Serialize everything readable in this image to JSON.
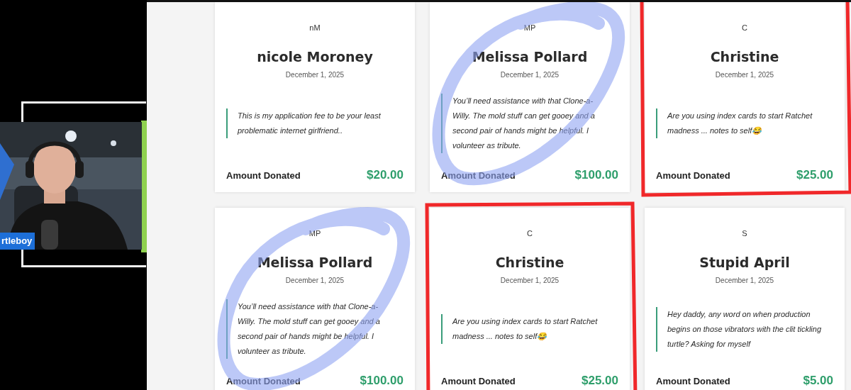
{
  "webcam": {
    "name_tag": "rtleboy"
  },
  "donations": [
    {
      "initials": "nM",
      "name": "nicole Moroney",
      "date": "December 1, 2025",
      "message": "This is my application fee to be your least problematic internet girlfriend..",
      "amount_label": "Amount Donated",
      "amount": "$20.00",
      "circled": false,
      "boxed": false
    },
    {
      "initials": "MP",
      "name": "Melissa Pollard",
      "date": "December 1, 2025",
      "message": "You’ll need assistance with that Clone-a-Willy. The mold stuff can get gooey and a second pair of hands might be helpful. I volunteer as tribute.",
      "amount_label": "Amount Donated",
      "amount": "$100.00",
      "circled": true,
      "boxed": false
    },
    {
      "initials": "C",
      "name": "Christine",
      "date": "December 1, 2025",
      "message": "Are you using index cards to start Ratchet madness ... notes to self😂",
      "amount_label": "Amount Donated",
      "amount": "$25.00",
      "circled": false,
      "boxed": true
    },
    {
      "initials": "MP",
      "name": "Melissa Pollard",
      "date": "December 1, 2025",
      "message": "You’ll need assistance with that Clone-a-Willy. The mold stuff can get gooey and a second pair of hands might be helpful. I volunteer as tribute.",
      "amount_label": "Amount Donated",
      "amount": "$100.00",
      "circled": true,
      "boxed": false
    },
    {
      "initials": "C",
      "name": "Christine",
      "date": "December 1, 2025",
      "message": "Are you using index cards to start Ratchet madness ... notes to self😂",
      "amount_label": "Amount Donated",
      "amount": "$25.00",
      "circled": false,
      "boxed": true
    },
    {
      "initials": "S",
      "name": "Stupid April",
      "date": "December 1, 2025",
      "message": "Hey daddy, any word on when production begins on those vibrators with the clit tickling turtle? Asking for myself",
      "amount_label": "Amount Donated",
      "amount": "$5.00",
      "circled": false,
      "boxed": false
    }
  ]
}
